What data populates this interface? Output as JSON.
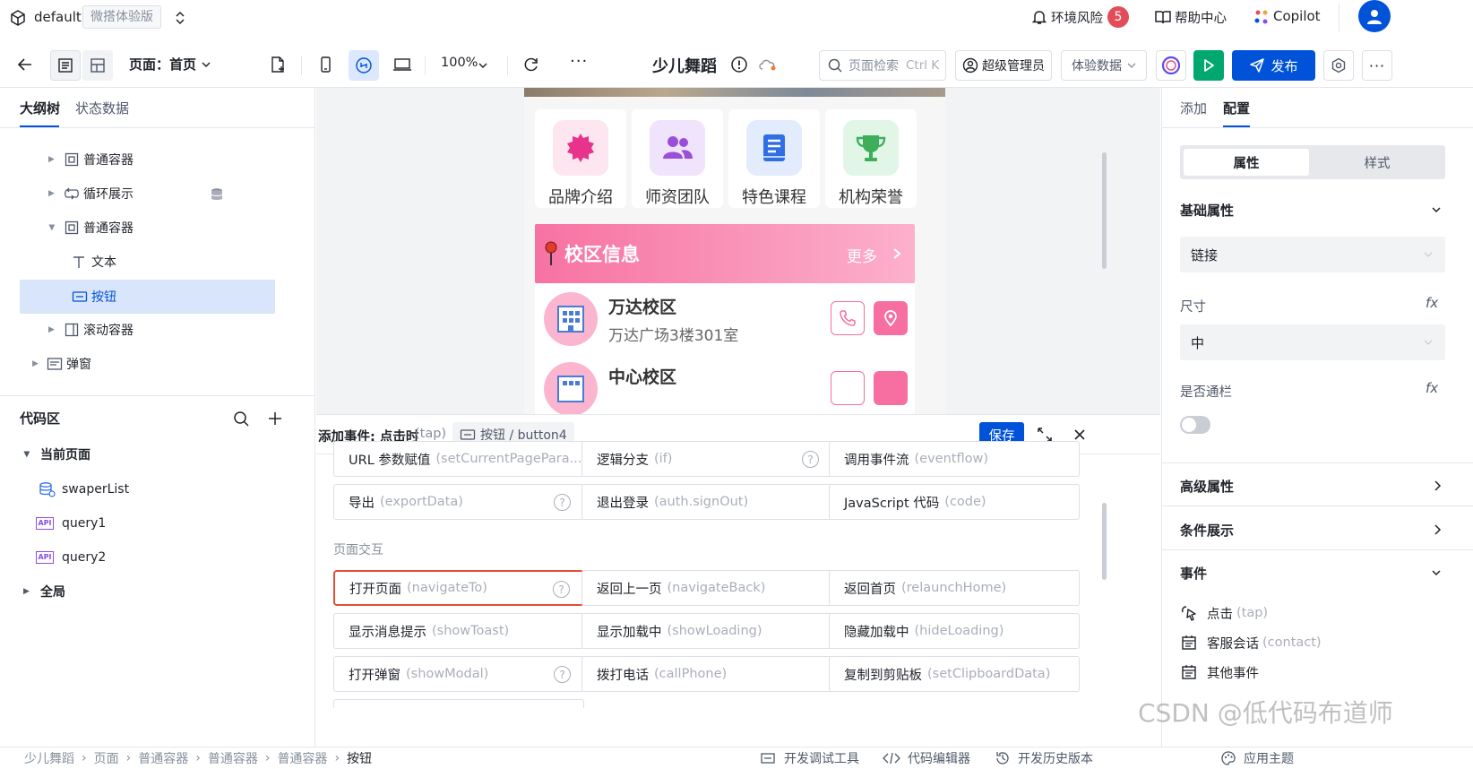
{
  "topbar": {
    "workspace": "default",
    "edition_badge": "微搭体验版",
    "env_risk": "环境风险",
    "env_risk_count": "5",
    "help": "帮助中心",
    "copilot": "Copilot"
  },
  "toolbar": {
    "page_label": "页面：首页",
    "zoom": "100%",
    "app_title": "少儿舞蹈",
    "search_placeholder": "页面检索",
    "search_shortcut": "Ctrl K",
    "admin": "超级管理员",
    "data_mode": "体验数据",
    "publish": "发布"
  },
  "left": {
    "tabs": [
      "大纲树",
      "状态数据"
    ],
    "tree": [
      {
        "label": "普通容器",
        "icon": "container-icon"
      },
      {
        "label": "循环展示",
        "icon": "loop-icon"
      },
      {
        "label": "普通容器",
        "icon": "container-icon"
      },
      {
        "label": "文本",
        "icon": "text-icon"
      },
      {
        "label": "按钮",
        "icon": "button-icon"
      },
      {
        "label": "滚动容器",
        "icon": "scroll-container-icon"
      },
      {
        "label": "弹窗",
        "icon": "modal-icon"
      }
    ],
    "code_title": "代码区",
    "current_page": "当前页面",
    "code_items": [
      "swaperList",
      "query1",
      "query2"
    ],
    "global": "全局"
  },
  "phone": {
    "menus": [
      {
        "label": "品牌介绍",
        "color": "#e8338b",
        "bg": "#fde6f0"
      },
      {
        "label": "师资团队",
        "color": "#9b4fd9",
        "bg": "#efe4fb"
      },
      {
        "label": "特色课程",
        "color": "#2f6fe6",
        "bg": "#e2ecfd"
      },
      {
        "label": "机构荣誉",
        "color": "#3fae5b",
        "bg": "#e2f6e7"
      }
    ],
    "campus_title": "校区信息",
    "more": "更多",
    "campuses": [
      {
        "name": "万达校区",
        "addr": "万达广场3楼301室"
      },
      {
        "name": "中心校区",
        "addr": ""
      }
    ]
  },
  "event": {
    "title": "添加事件: 点击时",
    "title_en": "(tap)",
    "target": "按钮 / button4",
    "save": "保存",
    "group_label": "页面交互",
    "row1": [
      {
        "cn": "URL 参数赋值",
        "en": "(setCurrentPagePara..."
      },
      {
        "cn": "逻辑分支",
        "en": "(if)"
      },
      {
        "cn": "调用事件流",
        "en": "(eventflow)"
      }
    ],
    "row2": [
      {
        "cn": "导出",
        "en": "(exportData)"
      },
      {
        "cn": "退出登录",
        "en": "(auth.signOut)"
      },
      {
        "cn": "JavaScript 代码",
        "en": "(code)"
      }
    ],
    "row3": [
      {
        "cn": "打开页面",
        "en": "(navigateTo)"
      },
      {
        "cn": "返回上一页",
        "en": "(navigateBack)"
      },
      {
        "cn": "返回首页",
        "en": "(relaunchHome)"
      }
    ],
    "row4": [
      {
        "cn": "显示消息提示",
        "en": "(showToast)"
      },
      {
        "cn": "显示加载中",
        "en": "(showLoading)"
      },
      {
        "cn": "隐藏加载中",
        "en": "(hideLoading)"
      }
    ],
    "row5": [
      {
        "cn": "打开弹窗",
        "en": "(showModal)"
      },
      {
        "cn": "拨打电话",
        "en": "(callPhone)"
      },
      {
        "cn": "复制到剪贴板",
        "en": "(setClipboardData)"
      }
    ]
  },
  "right": {
    "tabs": [
      "添加",
      "配置"
    ],
    "subtabs": [
      "属性",
      "样式"
    ],
    "basic": "基础属性",
    "link_value": "链接",
    "size_label": "尺寸",
    "size_value": "中",
    "block_label": "是否通栏",
    "advanced": "高级属性",
    "condition": "条件展示",
    "events": "事件",
    "event_items": [
      {
        "cn": "点击",
        "en": "(tap)"
      },
      {
        "cn": "客服会话",
        "en": "(contact)"
      },
      {
        "cn": "其他事件",
        "en": ""
      }
    ]
  },
  "status": {
    "crumbs": [
      "少儿舞蹈",
      "页面",
      "普通容器",
      "普通容器",
      "普通容器",
      "按钮"
    ],
    "devtools": "开发调试工具",
    "code_editor": "代码编辑器",
    "history": "开发历史版本",
    "theme": "应用主题",
    "watermark": "CSDN @低代码布道师"
  },
  "colors": {
    "primary": "#0052d9",
    "green": "#00a870",
    "pink": "#f76ea0",
    "danger": "#e34d59"
  }
}
